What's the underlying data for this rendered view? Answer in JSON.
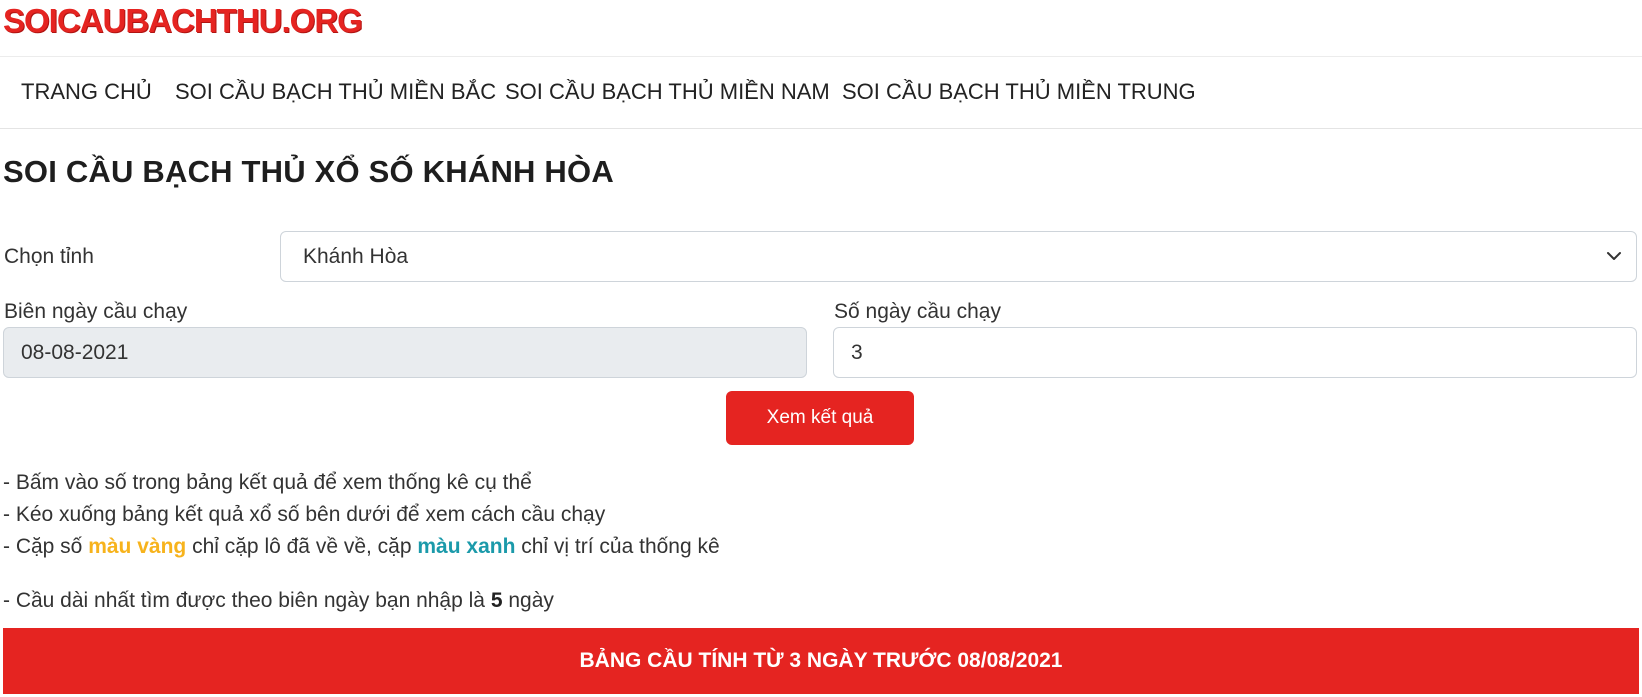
{
  "site": {
    "logo": "SOICAUBACHTHU.ORG"
  },
  "nav": {
    "items": [
      "TRANG CHỦ",
      "SOI CẦU BẠCH THỦ MIỀN BẮC",
      "SOI CẦU BẠCH THỦ MIỀN NAM",
      "SOI CẦU BẠCH THỦ MIỀN TRUNG"
    ]
  },
  "page": {
    "title": "SOI CẦU BẠCH THỦ XỔ SỐ KHÁNH HÒA"
  },
  "form": {
    "province_label": "Chọn tỉnh",
    "province_value": "Khánh Hòa",
    "date_label": "Biên ngày cầu chạy",
    "date_value": "08-08-2021",
    "days_label": "Số ngày cầu chạy",
    "days_value": "3",
    "submit_label": "Xem kết quả"
  },
  "notes": {
    "line1": "- Bấm vào số trong bảng kết quả để xem thống kê cụ thể",
    "line2": "- Kéo xuống bảng kết quả xổ số bên dưới để xem cách cầu chạy",
    "line3_a": "- Cặp số ",
    "line3_yellow": "màu vàng",
    "line3_b": " chỉ cặp lô đã về về, cặp ",
    "line3_teal": "màu xanh",
    "line3_c": " chỉ vị trí của thống kê",
    "line4_a": "- Cầu dài nhất tìm được theo biên ngày bạn nhập là ",
    "line4_bold": "5",
    "line4_b": " ngày"
  },
  "banner": {
    "text": "BẢNG CẦU TÍNH TỪ 3 NGÀY TRƯỚC 08/08/2021"
  },
  "colors": {
    "accent": "#e52421",
    "yellow": "#f7b31c",
    "teal": "#1b9aaa"
  }
}
